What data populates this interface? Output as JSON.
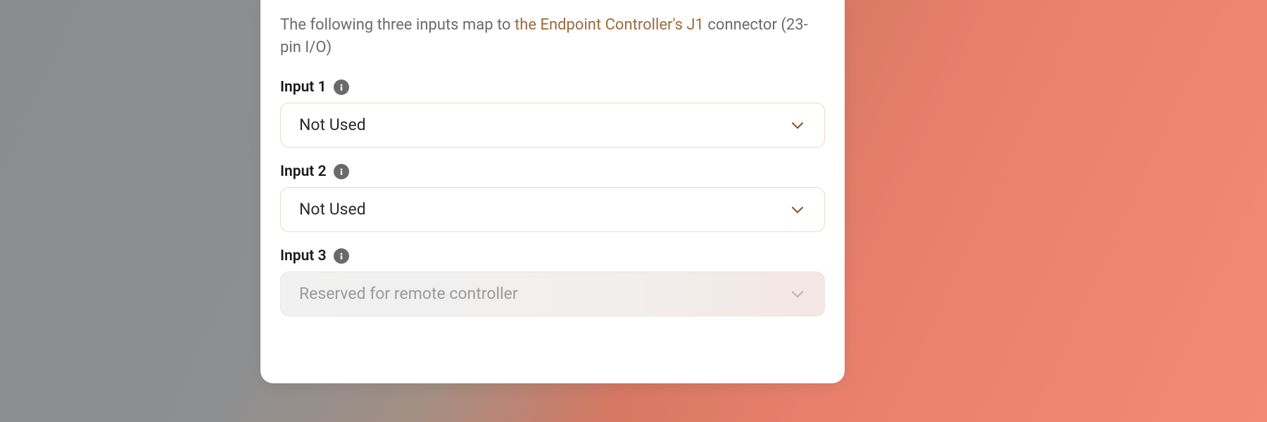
{
  "description": {
    "prefix": "The following three inputs map to ",
    "emph": "the Endpoint Controller's J1",
    "suffix": " connector (23-pin I/O)"
  },
  "inputs": {
    "i1": {
      "label": "Input 1",
      "value": "Not Used",
      "disabled": false
    },
    "i2": {
      "label": "Input 2",
      "value": "Not Used",
      "disabled": false
    },
    "i3": {
      "label": "Input 3",
      "value": "Reserved for remote controller",
      "disabled": true
    }
  }
}
